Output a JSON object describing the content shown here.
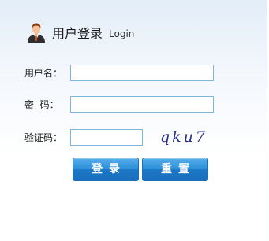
{
  "header": {
    "title_cn": "用户登录",
    "title_en": "Login",
    "icon": "user-avatar-icon"
  },
  "form": {
    "username_label": "用户名：",
    "password_label": "密  码：",
    "captcha_label": "验证码：",
    "username_value": "",
    "password_value": "",
    "captcha_value": "",
    "captcha_image_text": "qku7"
  },
  "buttons": {
    "login_label": "登录",
    "reset_label": "重置"
  },
  "colors": {
    "button": "#2c8fd9",
    "input_border": "#7fb6d9",
    "captcha_text": "#2b2e8c"
  }
}
